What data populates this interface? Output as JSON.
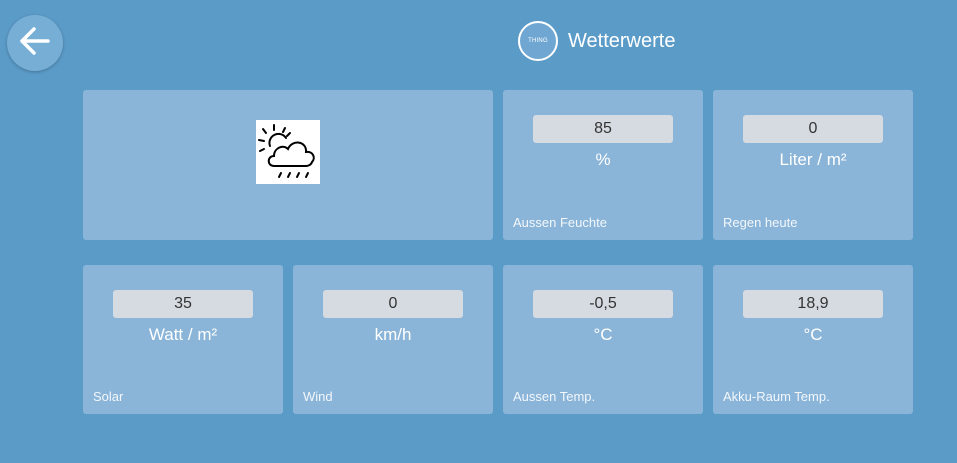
{
  "header": {
    "title": "Wetterwerte",
    "thing_icon_label": "THING"
  },
  "icons": {
    "back": "arrow-left-icon",
    "weather": "partly-cloudy-rain-icon"
  },
  "tiles": [
    {
      "value": "85",
      "unit": "%",
      "caption": "Aussen Feuchte"
    },
    {
      "value": "0",
      "unit": "Liter / m²",
      "caption": "Regen heute"
    },
    {
      "value": "35",
      "unit": "Watt / m²",
      "caption": "Solar"
    },
    {
      "value": "0",
      "unit": "km/h",
      "caption": "Wind"
    },
    {
      "value": "-0,5",
      "unit": "°C",
      "caption": "Aussen Temp."
    },
    {
      "value": "18,9",
      "unit": "°C",
      "caption": "Akku-Raum Temp."
    }
  ],
  "colors": {
    "background": "#5b9bc8",
    "tile": "#8ab5d9",
    "value_box": "#d6dbe1"
  }
}
